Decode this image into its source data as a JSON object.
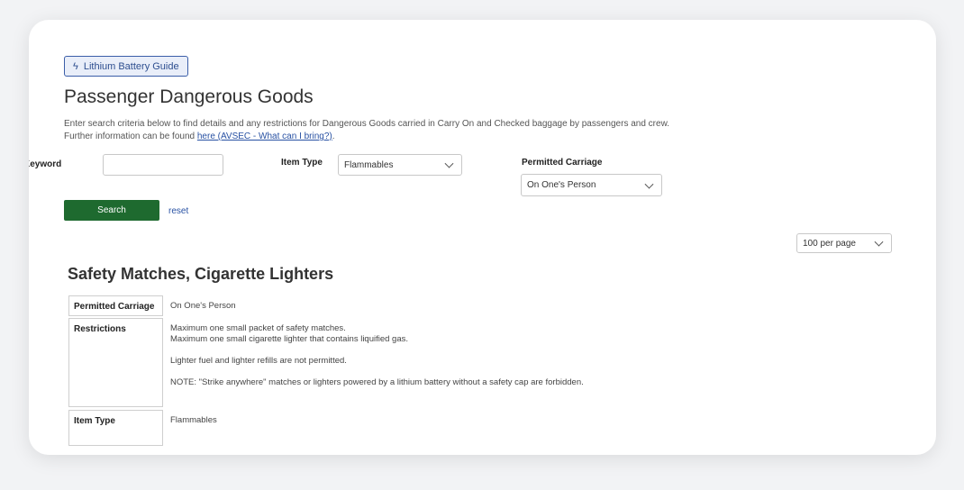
{
  "guide_button": {
    "label": "Lithium Battery Guide",
    "icon": "lightning-icon"
  },
  "page": {
    "title": "Passenger Dangerous Goods",
    "description_line1": "Enter search criteria below to find details and any restrictions for Dangerous Goods carried in Carry On and Checked baggage by passengers and crew.",
    "description_line2_prefix": "Further information can be found ",
    "description_link": "here (AVSEC - What can I bring?)",
    "description_line2_suffix": "."
  },
  "filters": {
    "keyword_label": "Keyword",
    "keyword_value": "",
    "item_type_label": "Item Type",
    "item_type_value": "Flammables",
    "permitted_carriage_label": "Permitted Carriage",
    "permitted_carriage_value": "On One's Person"
  },
  "actions": {
    "search_label": "Search",
    "reset_label": "reset"
  },
  "pagination": {
    "per_page": "100 per page"
  },
  "result": {
    "title": "Safety Matches, Cigarette Lighters",
    "rows": [
      {
        "label": "Permitted Carriage",
        "lines": [
          "On One's Person"
        ]
      },
      {
        "label": "Restrictions",
        "lines": [
          "Maximum one small packet of safety matches.",
          "Maximum one small cigarette lighter that contains liquified gas.",
          "",
          "Lighter fuel and lighter refills are not permitted.",
          "",
          "NOTE: \"Strike anywhere\" matches or lighters powered by a lithium battery without a safety cap are forbidden."
        ]
      },
      {
        "label": "Item Type",
        "lines": [
          "Flammables"
        ]
      }
    ]
  },
  "colors": {
    "accent_green": "#1e6a2f",
    "link_blue": "#2851a3",
    "guide_border": "#3b5ea8"
  }
}
